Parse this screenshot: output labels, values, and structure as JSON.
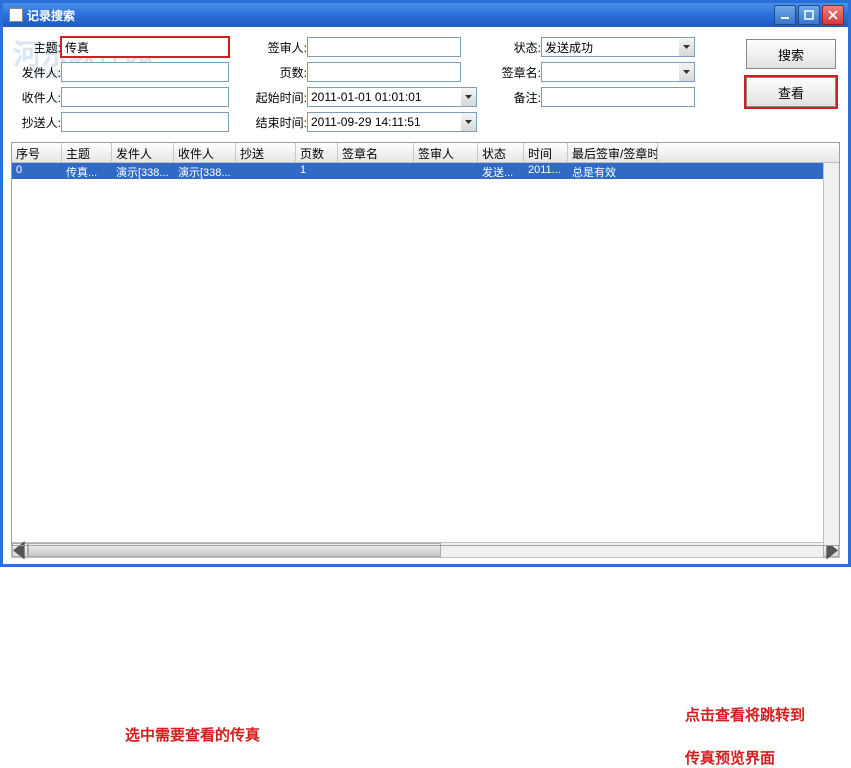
{
  "window": {
    "title": "记录搜索"
  },
  "watermark": {
    "line1": "河东软件园",
    "line2": "www.pc0359.cn"
  },
  "form": {
    "col1": {
      "subject_label": "主题:",
      "subject_value": "传真",
      "sender_label": "发件人:",
      "sender_value": "",
      "receiver_label": "收件人:",
      "receiver_value": "",
      "cc_label": "抄送人:",
      "cc_value": ""
    },
    "col2": {
      "reviewer_label": "签审人:",
      "reviewer_value": "",
      "pages_label": "页数:",
      "pages_value": "",
      "start_label": "起始时间:",
      "start_value": "2011-01-01 01:01:01",
      "end_label": "结束时间:",
      "end_value": "2011-09-29 14:11:51"
    },
    "col3": {
      "status_label": "状态:",
      "status_value": "发送成功",
      "stamp_label": "签章名:",
      "stamp_value": "",
      "remark_label": "备注:",
      "remark_value": ""
    }
  },
  "buttons": {
    "search": "搜索",
    "view": "查看"
  },
  "table": {
    "headers": [
      "序号",
      "主题",
      "发件人",
      "收件人",
      "抄送",
      "页数",
      "签章名",
      "签审人",
      "状态",
      "时间",
      "最后签审/签章时"
    ],
    "widths": [
      50,
      50,
      62,
      62,
      60,
      42,
      76,
      64,
      46,
      44,
      90
    ],
    "rows": [
      {
        "cells": [
          "0",
          "传真...",
          "演示[338...",
          "演示[338...",
          "",
          "1",
          "",
          "",
          "发送...",
          "2011...",
          "总是有效"
        ]
      }
    ]
  },
  "annotations": {
    "a1": "选中需要查看的传真",
    "a2": "点击查看将跳转到",
    "a3": "传真预览界面"
  }
}
